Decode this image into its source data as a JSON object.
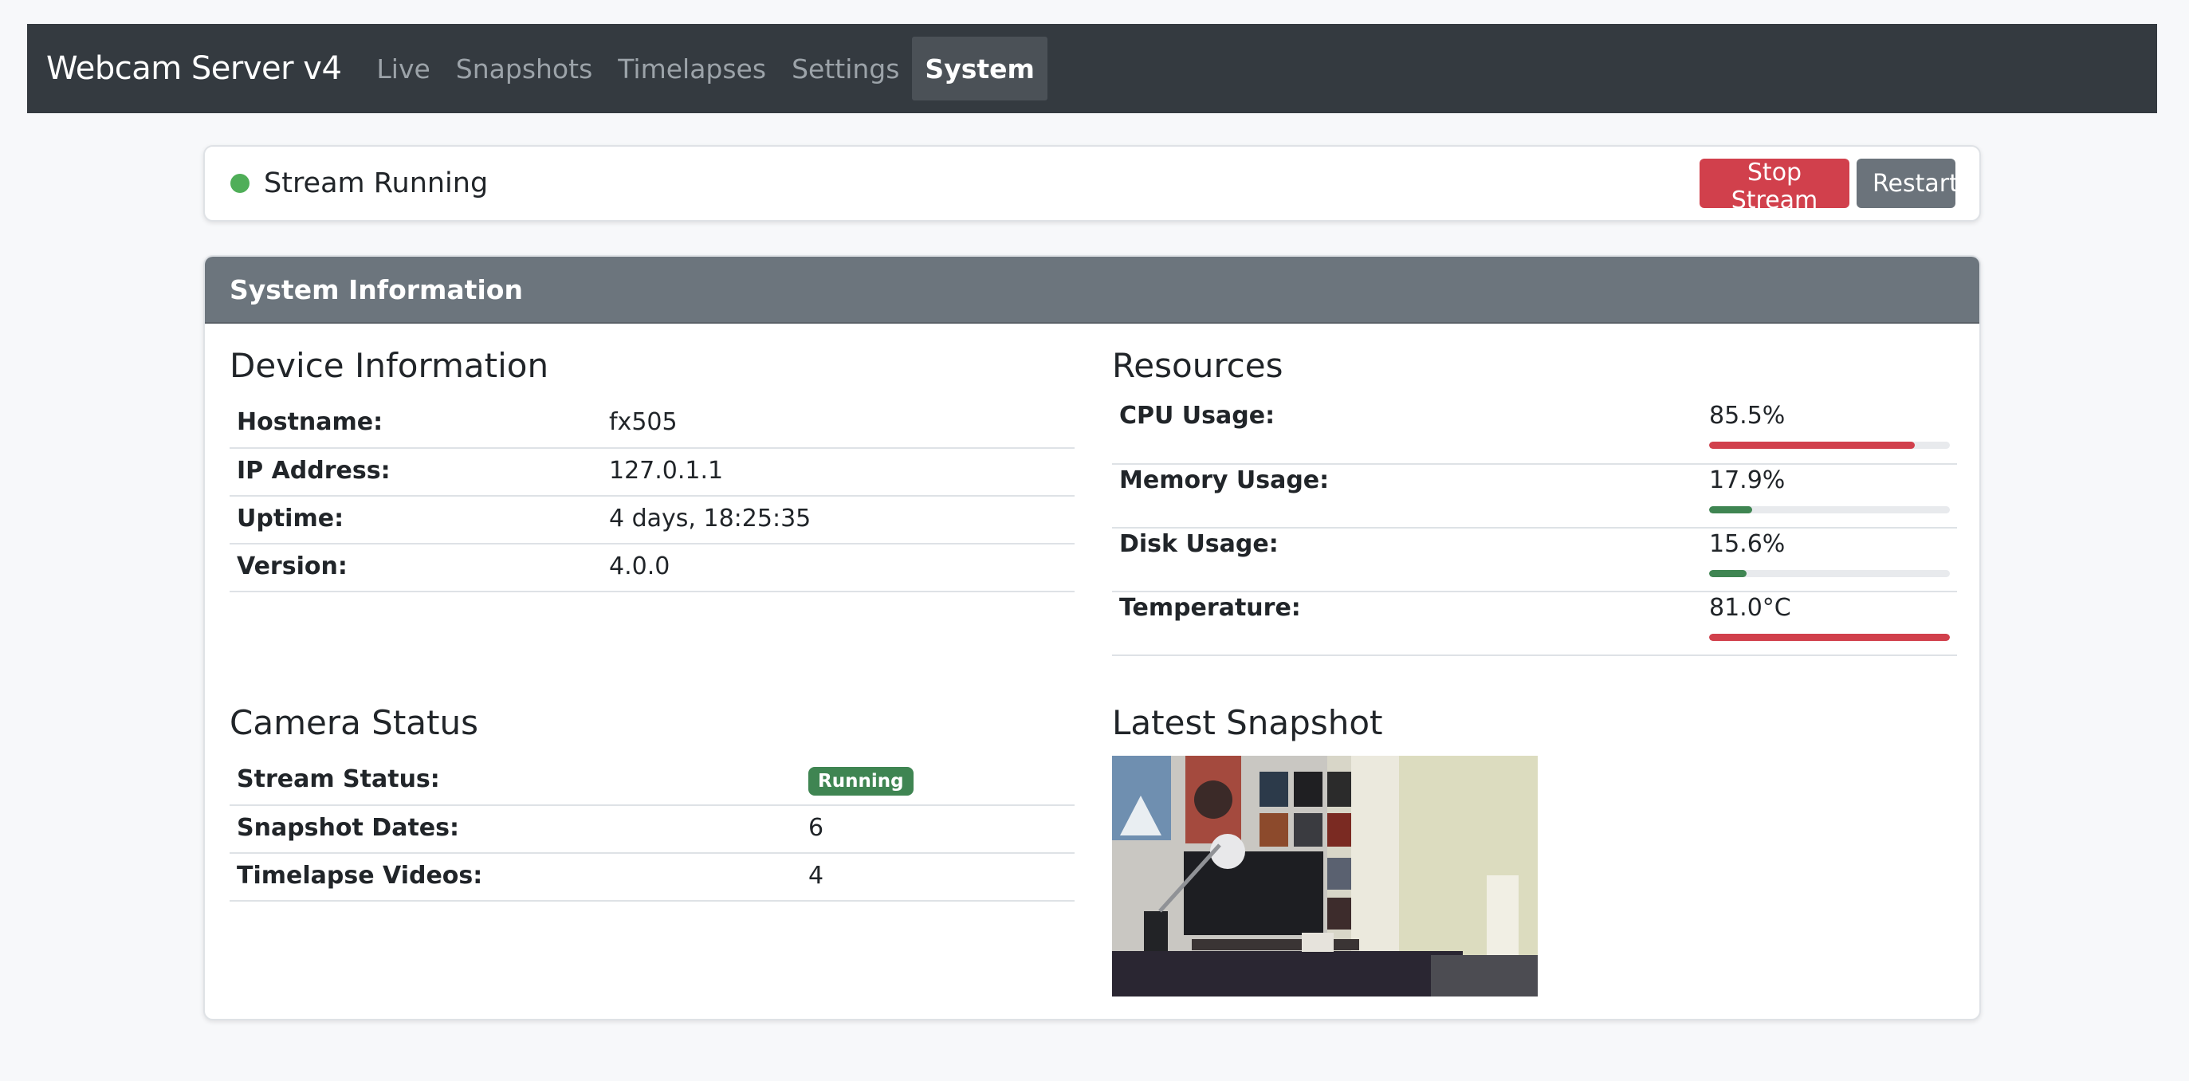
{
  "navbar": {
    "brand": "Webcam Server v4",
    "items": [
      {
        "label": "Live",
        "active": false
      },
      {
        "label": "Snapshots",
        "active": false
      },
      {
        "label": "Timelapses",
        "active": false
      },
      {
        "label": "Settings",
        "active": false
      },
      {
        "label": "System",
        "active": true
      }
    ]
  },
  "stream": {
    "status_text": "Stream Running",
    "status_color": "#4fae58",
    "stop_label": "Stop Stream",
    "restart_label": "Restart"
  },
  "system": {
    "title": "System Information",
    "device": {
      "title": "Device Information",
      "rows": [
        {
          "key": "Hostname:",
          "value": "fx505"
        },
        {
          "key": "IP Address:",
          "value": "127.0.1.1"
        },
        {
          "key": "Uptime:",
          "value": "4 days, 18:25:35"
        },
        {
          "key": "Version:",
          "value": "4.0.0"
        }
      ]
    },
    "resources": {
      "title": "Resources",
      "rows": [
        {
          "key": "CPU Usage:",
          "value": "85.5%",
          "level": 0.855,
          "color": "#d1404c"
        },
        {
          "key": "Memory Usage:",
          "value": "17.9%",
          "level": 0.179,
          "color": "#3f8552"
        },
        {
          "key": "Disk Usage:",
          "value": "15.6%",
          "level": 0.156,
          "color": "#3f8552"
        },
        {
          "key": "Temperature:",
          "value": "81.0°C",
          "level": 1.0,
          "color": "#d1404c"
        }
      ]
    },
    "camera": {
      "title": "Camera Status",
      "rows": [
        {
          "key": "Stream Status:",
          "value": "Running",
          "badge": true
        },
        {
          "key": "Snapshot Dates:",
          "value": "6"
        },
        {
          "key": "Timelapse Videos:",
          "value": "4"
        }
      ]
    },
    "snapshot": {
      "title": "Latest Snapshot"
    }
  }
}
